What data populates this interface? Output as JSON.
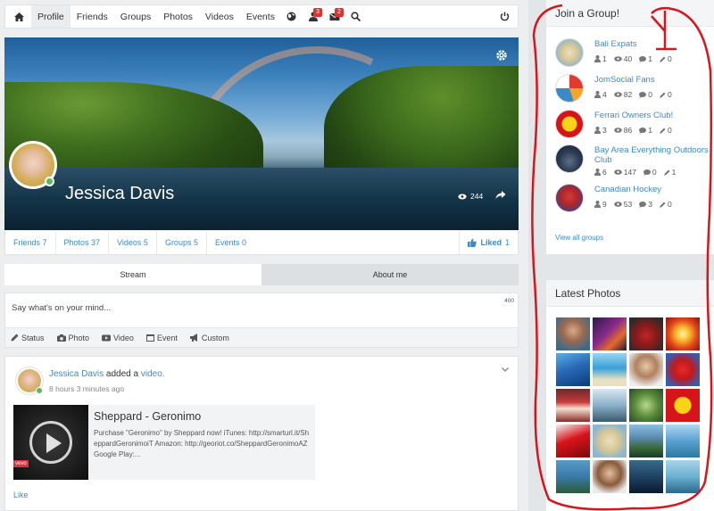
{
  "nav": {
    "items": [
      "Profile",
      "Friends",
      "Groups",
      "Photos",
      "Videos",
      "Events"
    ],
    "notification_count": "3",
    "message_count": "2"
  },
  "cover": {
    "name": "Jessica Davis",
    "views": "244"
  },
  "stats": {
    "friends": "Friends 7",
    "photos": "Photos 37",
    "videos": "Videos 5",
    "groups": "Groups 5",
    "events": "Events 0",
    "liked": "Liked",
    "liked_count": "1"
  },
  "tabs": {
    "stream": "Stream",
    "about": "About me"
  },
  "composer": {
    "placeholder": "Say what's on your mind...",
    "char_count": "400",
    "tools": [
      "Status",
      "Photo",
      "Video",
      "Event",
      "Custom"
    ]
  },
  "post": {
    "actor": "Jessica Davis",
    "verb": "added a",
    "object": "video.",
    "time": "8 hours 3 minutes ago",
    "card_title": "Sheppard - Geronimo",
    "card_desc": "Purchase \"Geronimo\" by Sheppard now! iTunes: http://smarturl.it/SheppardGeronimoiT Amazon: http://georiot.co/SheppardGeronimoAZ Google Play:...",
    "thumb_badge": "vevo",
    "like": "Like"
  },
  "groups_panel": {
    "title": "Join a Group!",
    "groups": [
      {
        "name": "Bali Expats",
        "members": "1",
        "views": "40",
        "comments": "1",
        "edits": "0"
      },
      {
        "name": "JomSocial Fans",
        "members": "4",
        "views": "82",
        "comments": "0",
        "edits": "0"
      },
      {
        "name": "Ferrari Owners Club!",
        "members": "3",
        "views": "86",
        "comments": "1",
        "edits": "0"
      },
      {
        "name": "Bay Area Everything Outdoors Club",
        "members": "6",
        "views": "147",
        "comments": "0",
        "edits": "1"
      },
      {
        "name": "Canadian Hockey",
        "members": "9",
        "views": "53",
        "comments": "3",
        "edits": "0"
      }
    ],
    "view_all": "View all groups"
  },
  "photos_panel": {
    "title": "Latest Photos"
  },
  "colors": {
    "link": "#3a8ac9",
    "badge": "#e0312b",
    "online": "#5cb85c",
    "annotation": "#d9141b"
  }
}
